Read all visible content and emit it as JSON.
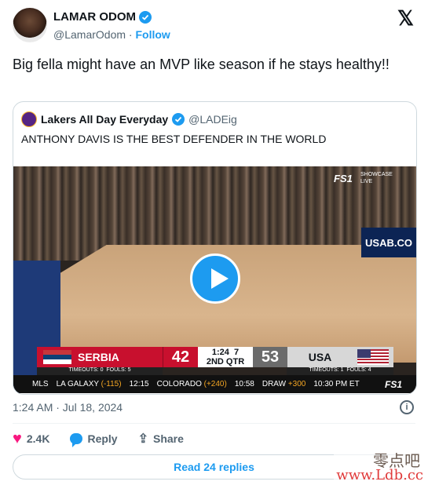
{
  "author": {
    "name": "LAMAR ODOM",
    "handle": "@LamarOdom",
    "separator": "·",
    "follow_label": "Follow"
  },
  "tweet_text": "Big fella might have an MVP like season if he stays healthy!!",
  "quote": {
    "name": "Lakers All Day Everyday",
    "handle": "@LADEig",
    "text": "ANTHONY DAVIS IS THE BEST DEFENDER IN THE WORLD",
    "video": {
      "network": "FS1",
      "showcase": "SHOWCASE",
      "live": "LIVE",
      "banner": "USAB.CO",
      "team1": {
        "name": "SERBIA",
        "score": "42",
        "timeouts": "TIMEOUTS: 0",
        "fouls": "FOULS: 5"
      },
      "clock": "1:24",
      "shot_clock": "7",
      "period": "2ND QTR",
      "team2": {
        "name": "USA",
        "score": "53",
        "timeouts": "TIMEOUTS: 1",
        "fouls": "FOULS: 4"
      },
      "ticker": {
        "league": "MLS",
        "team_a": "LA GALAXY",
        "odds_a": "(-115)",
        "time_a": "12:15",
        "team_b": "COLORADO",
        "odds_b": "(+240)",
        "time_b": "10:58",
        "draw": "DRAW",
        "odds_draw": "+300",
        "kickoff": "10:30 PM ET",
        "network": "FS1"
      }
    }
  },
  "timestamp": "1:24 AM · Jul 18, 2024",
  "actions": {
    "likes": "2.4K",
    "reply_label": "Reply",
    "share_label": "Share"
  },
  "read_replies": "Read 24 replies",
  "watermark": {
    "line1": "零点吧",
    "line2": "www.Ldb.cc"
  },
  "colors": {
    "accent": "#1d9bf0",
    "like": "#f91880",
    "serbia": "#c8102e"
  }
}
